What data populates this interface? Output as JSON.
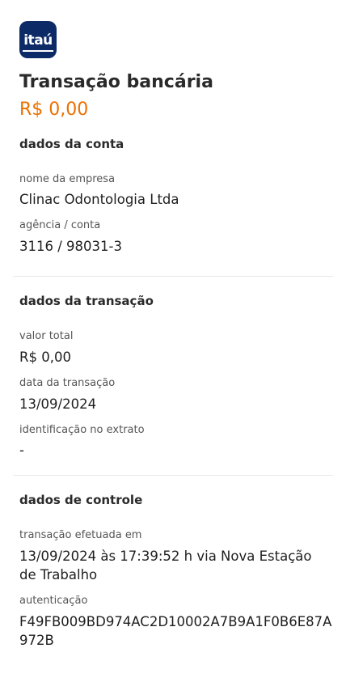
{
  "brand": {
    "logo_text": "itaú",
    "logo_color": "#0b2a66"
  },
  "header": {
    "title": "Transação bancária",
    "amount": "R$ 0,00",
    "amount_color": "#ec7000"
  },
  "account": {
    "section_title": "dados da conta",
    "company_label": "nome da empresa",
    "company_value": "Clinac Odontologia Ltda",
    "branch_label": "agência / conta",
    "branch_value": "3116 / 98031-3"
  },
  "transaction": {
    "section_title": "dados da transação",
    "total_label": "valor total",
    "total_value": "R$ 0,00",
    "date_label": "data da transação",
    "date_value": "13/09/2024",
    "statement_label": "identificação no extrato",
    "statement_value": "-"
  },
  "control": {
    "section_title": "dados de controle",
    "performed_label": "transação efetuada em",
    "performed_value_line1": "13/09/2024 às 17:39:52 h via Nova Estação",
    "performed_value_line2": "de Trabalho",
    "auth_label": "autenticação",
    "auth_value_line1": "F49FB009BD974AC2D10002A7B9A1F0B6E87A",
    "auth_value_line2": "972B"
  }
}
